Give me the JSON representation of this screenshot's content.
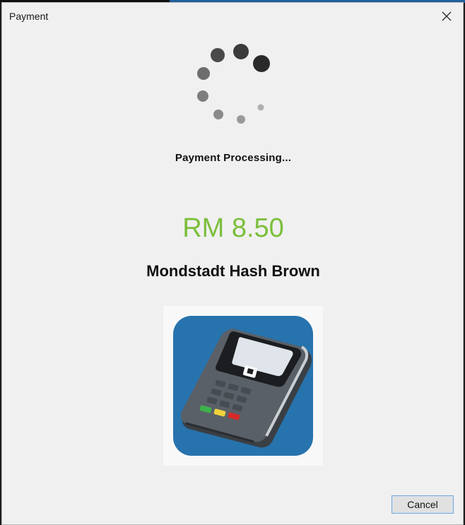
{
  "window": {
    "title": "Payment"
  },
  "status": {
    "message": "Payment Processing..."
  },
  "payment": {
    "amount": "RM 8.50",
    "item_name": "Mondstadt Hash Brown"
  },
  "buttons": {
    "cancel_label": "Cancel"
  },
  "colors": {
    "amount": "#7bbf3b",
    "terminal_background": "#2773ad"
  },
  "icons": {
    "close": "close-icon",
    "spinner": "loading-spinner-icon",
    "terminal": "card-terminal-image"
  }
}
